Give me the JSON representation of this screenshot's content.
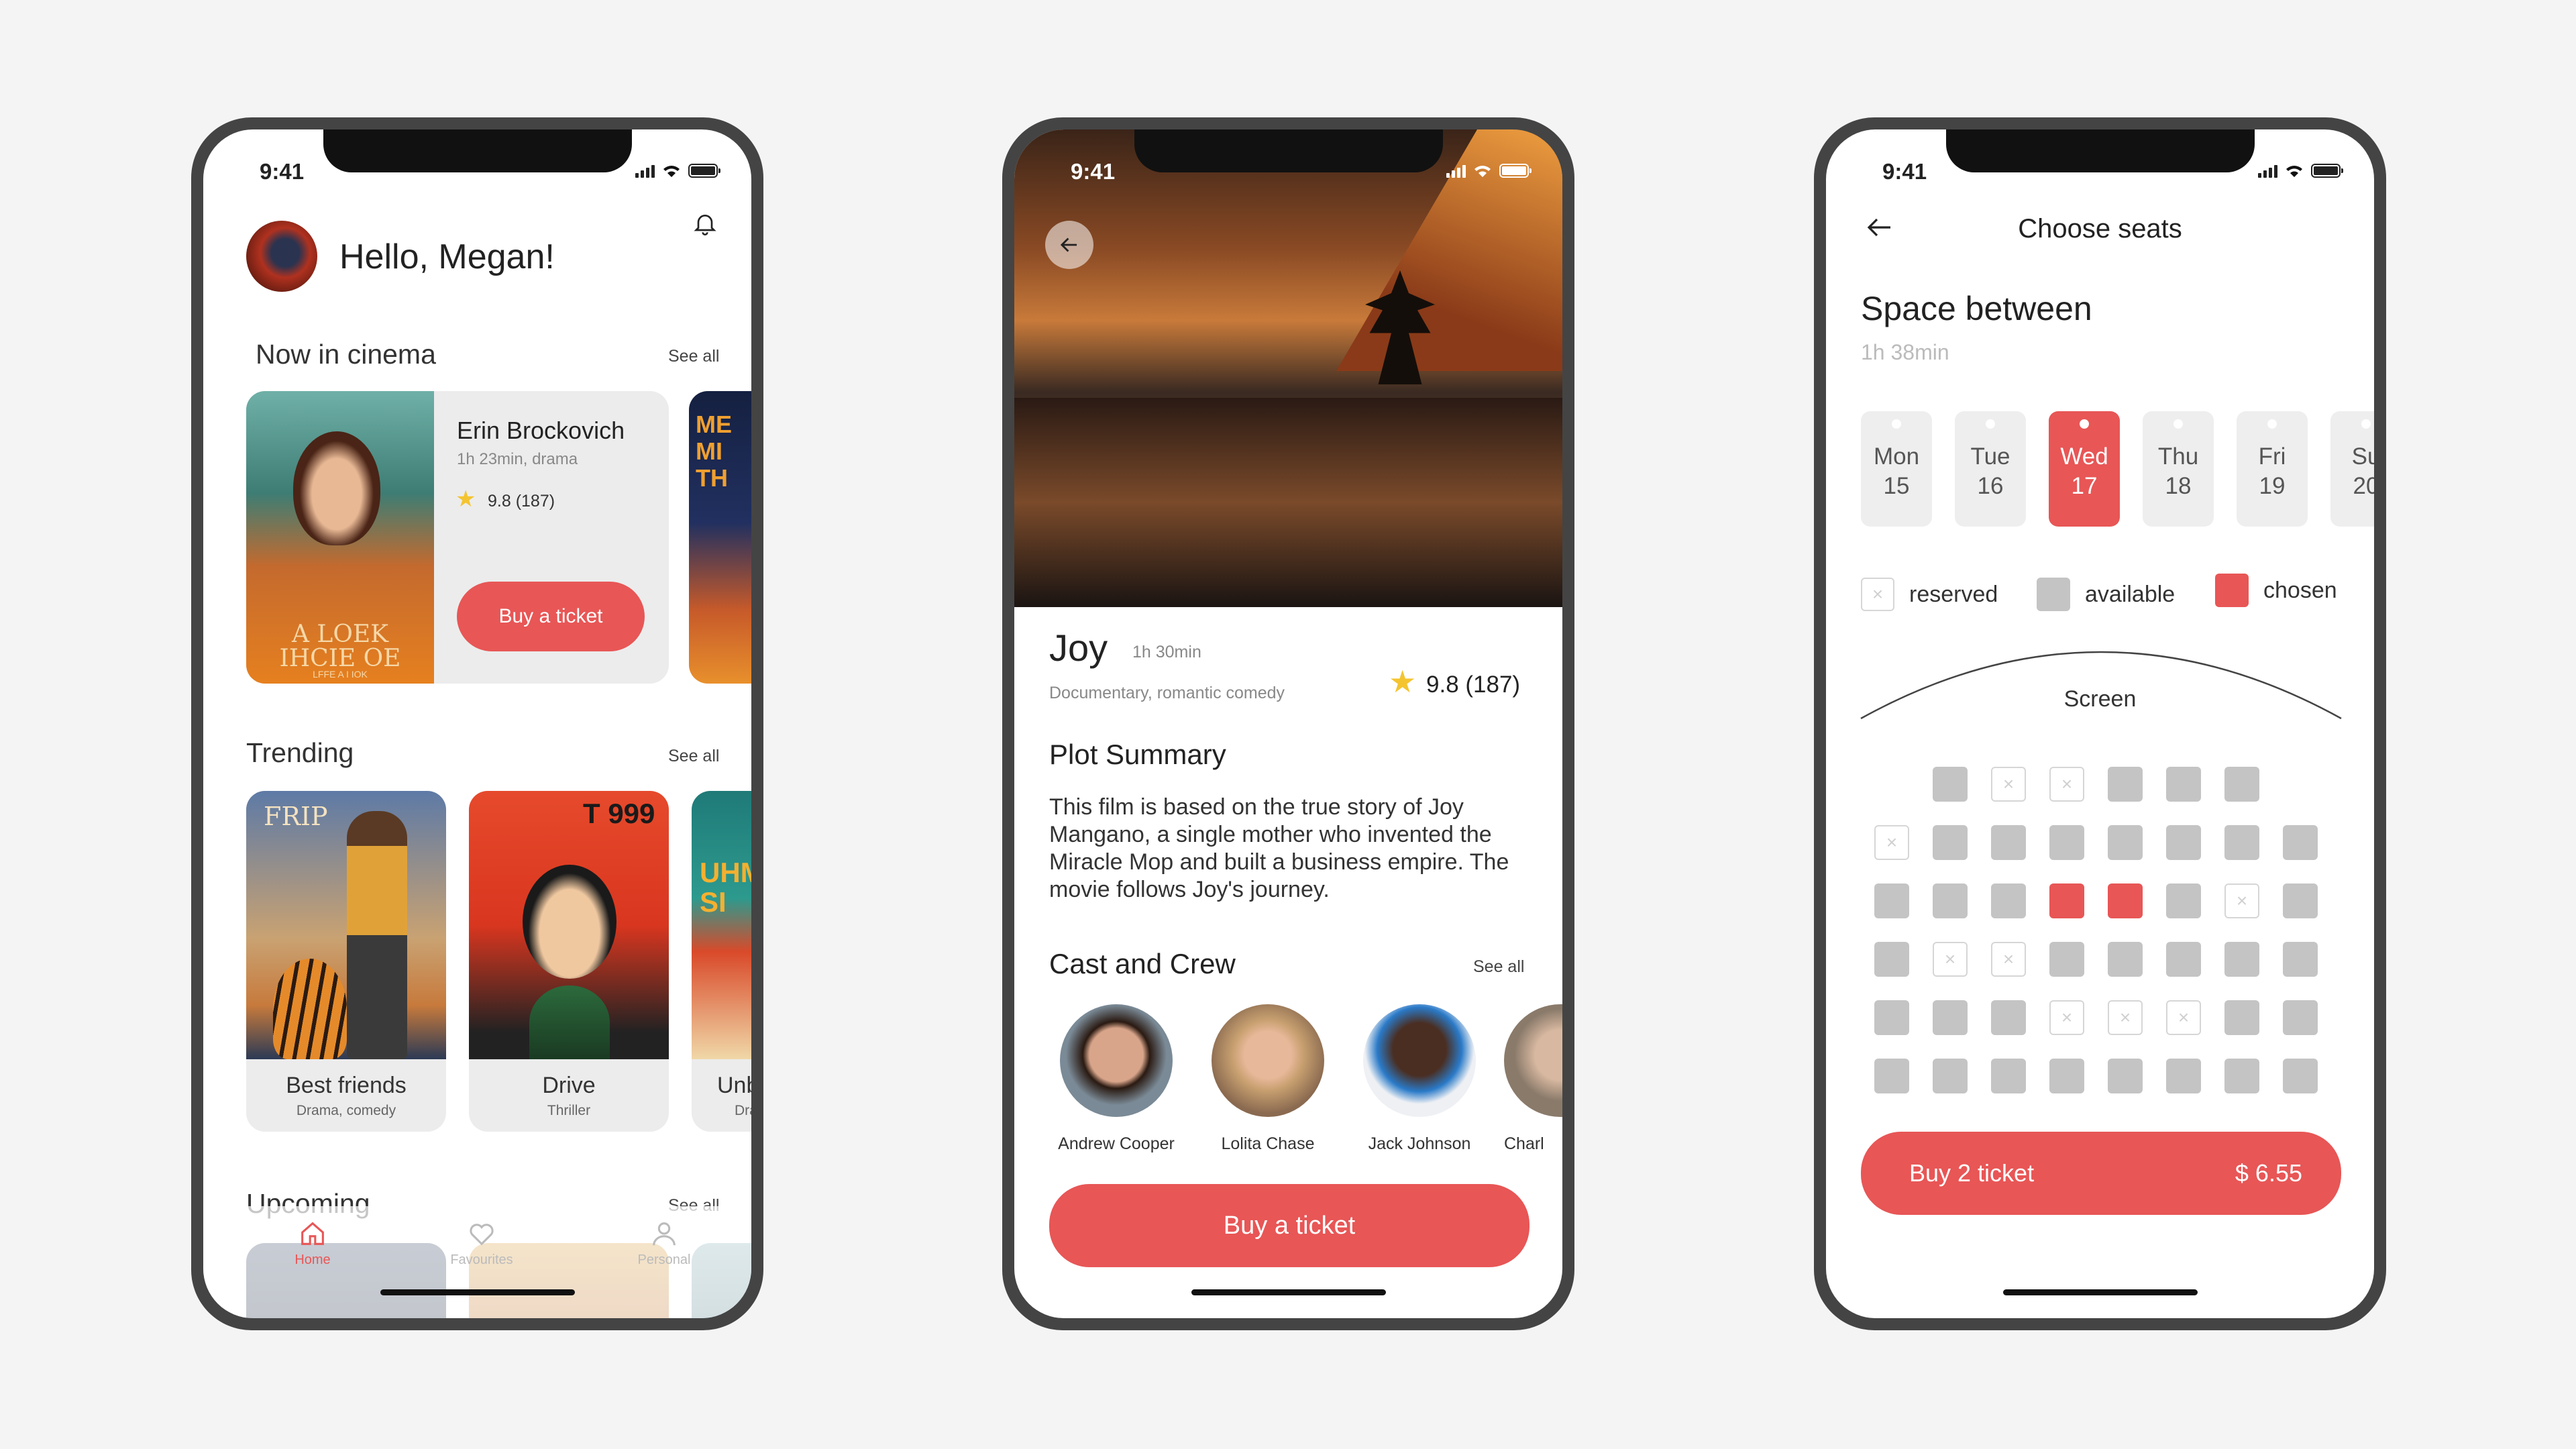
{
  "status": {
    "time": "9:41"
  },
  "home": {
    "greeting": "Hello, Megan!",
    "now_in_cinema": {
      "title": "Now in cinema",
      "see_all": "See all",
      "feature": {
        "title": "Erin Brockovich",
        "meta": "1h 23min, drama",
        "rating": "9.8 (187)",
        "button": "Buy a ticket",
        "poster_text": "A LOEK IHCIE OE",
        "poster_sub": "LFFE A I IOK"
      },
      "next_poster_text": "ME MI TH"
    },
    "trending": {
      "title": "Trending",
      "see_all": "See all",
      "items": [
        {
          "title": "Best friends",
          "genre": "Drama, comedy",
          "poster_text": "FRIP"
        },
        {
          "title": "Drive",
          "genre": "Thriller",
          "poster_text": "T 999"
        },
        {
          "title": "Unb",
          "genre": "Dra",
          "poster_text": "UHME SI"
        }
      ]
    },
    "upcoming": {
      "title": "Upcoming",
      "see_all": "See all"
    },
    "tabs": [
      {
        "label": "Home",
        "active": true
      },
      {
        "label": "Favourites"
      },
      {
        "label": "Personal"
      }
    ]
  },
  "detail": {
    "title": "Joy",
    "duration": "1h 30min",
    "genres": "Documentary, romantic comedy",
    "rating": "9.8 (187)",
    "plot_title": "Plot Summary",
    "plot": "This film is based on the true story of Joy Mangano, a single mother who invented the Miracle Mop and built a business empire. The movie follows Joy's journey.",
    "cast_title": "Cast and Crew",
    "see_all": "See all",
    "cast": [
      "Andrew Cooper",
      "Lolita Chase",
      "Jack Johnson",
      "Charl"
    ],
    "button": "Buy a ticket"
  },
  "seats": {
    "header": "Choose seats",
    "movie": "Space between",
    "duration": "1h 38min",
    "days": [
      {
        "day": "Mon",
        "date": "15",
        "selected": false
      },
      {
        "day": "Tue",
        "date": "16",
        "selected": false
      },
      {
        "day": "Wed",
        "date": "17",
        "selected": true
      },
      {
        "day": "Thu",
        "date": "18",
        "selected": false
      },
      {
        "day": "Fri",
        "date": "19",
        "selected": false
      },
      {
        "day": "Su",
        "date": "20",
        "selected": false
      }
    ],
    "legend": {
      "reserved": "reserved",
      "available": "available",
      "chosen": "chosen"
    },
    "screen": "Screen",
    "rows": [
      [
        "n",
        "a",
        "r",
        "r",
        "a",
        "a",
        "a",
        "n"
      ],
      [
        "r",
        "a",
        "a",
        "a",
        "a",
        "a",
        "a",
        "a"
      ],
      [
        "a",
        "a",
        "a",
        "c",
        "c",
        "a",
        "r",
        "a"
      ],
      [
        "a",
        "r",
        "r",
        "a",
        "a",
        "a",
        "a",
        "a"
      ],
      [
        "a",
        "a",
        "a",
        "r",
        "r",
        "r",
        "a",
        "a"
      ],
      [
        "a",
        "a",
        "a",
        "a",
        "a",
        "a",
        "a",
        "a"
      ]
    ],
    "buy_label": "Buy 2 ticket",
    "price": "$ 6.55"
  },
  "colors": {
    "accent": "#e85656",
    "seat_available": "#c4c4c4",
    "seat_reserved_border": "#d6d6d6"
  }
}
